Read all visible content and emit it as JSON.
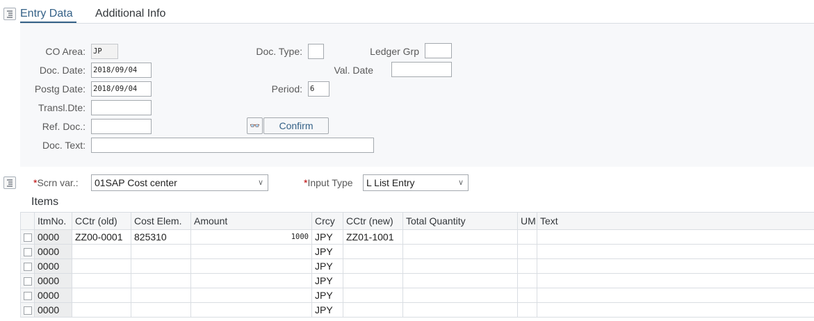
{
  "tabs": [
    {
      "label": "Entry Data",
      "active": true
    },
    {
      "label": "Additional Info",
      "active": false
    }
  ],
  "header": {
    "co_area": {
      "label": "CO Area:",
      "value": "JP"
    },
    "doc_date": {
      "label": "Doc. Date:",
      "value": "2018/09/04"
    },
    "postg_date": {
      "label": "Postg Date:",
      "value": "2018/09/04"
    },
    "transl_dte": {
      "label": "Transl.Dte:",
      "value": ""
    },
    "ref_doc": {
      "label": "Ref. Doc.:",
      "value": ""
    },
    "doc_text": {
      "label": "Doc. Text:",
      "value": ""
    },
    "doc_type": {
      "label": "Doc. Type:",
      "value": ""
    },
    "period": {
      "label": "Period:",
      "value": "6"
    },
    "ledger_grp": {
      "label": "Ledger Grp",
      "value": ""
    },
    "val_date": {
      "label": "Val. Date",
      "value": ""
    },
    "confirm_label": "Confirm",
    "search_icon": "binoculars-icon"
  },
  "screen": {
    "scrn_var_label": "Scrn var.:",
    "scrn_var_value": "01SAP Cost center",
    "input_type_label": "Input Type",
    "input_type_value": "L List Entry",
    "required_mark": "*"
  },
  "items": {
    "title": "Items",
    "columns": [
      "ItmNo.",
      "CCtr (old)",
      "Cost Elem.",
      "Amount",
      "Crcy",
      "CCtr (new)",
      "Total Quantity",
      "UM",
      "Text"
    ],
    "rows": [
      [
        "0000",
        "ZZ00-0001",
        "825310",
        "1000",
        "JPY",
        "ZZ01-1001",
        "",
        "",
        ""
      ],
      [
        "0000",
        "",
        "",
        "",
        "JPY",
        "",
        "",
        "",
        ""
      ],
      [
        "0000",
        "",
        "",
        "",
        "JPY",
        "",
        "",
        "",
        ""
      ],
      [
        "0000",
        "",
        "",
        "",
        "JPY",
        "",
        "",
        "",
        ""
      ],
      [
        "0000",
        "",
        "",
        "",
        "JPY",
        "",
        "",
        "",
        ""
      ],
      [
        "0000",
        "",
        "",
        "",
        "JPY",
        "",
        "",
        "",
        ""
      ]
    ]
  },
  "colors": {
    "accent": "#346187",
    "required": "#bb0000"
  }
}
